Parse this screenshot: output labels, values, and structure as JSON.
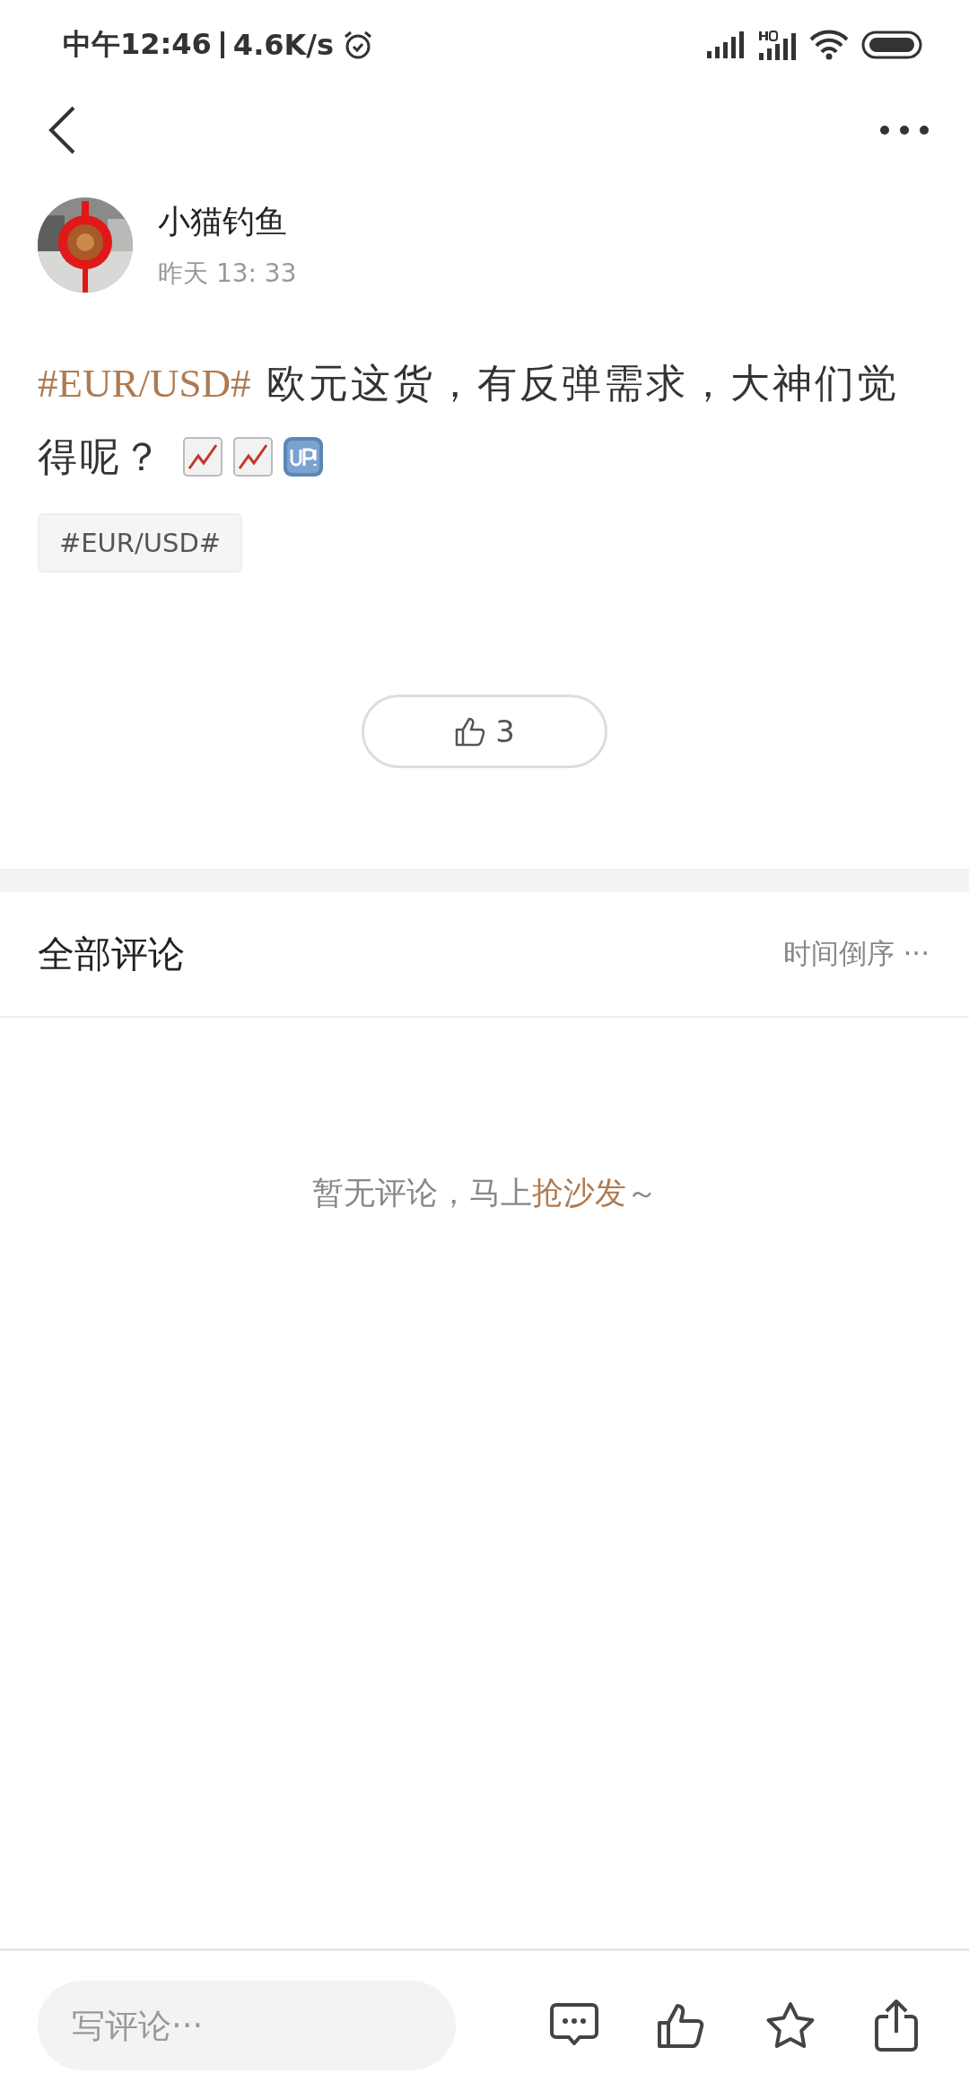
{
  "status_bar": {
    "time": "中午12:46",
    "speed": "4.6K/s"
  },
  "post": {
    "author": "小猫钓鱼",
    "time": "昨天 13: 33",
    "hashtag": "#EUR/USD#",
    "text_lines": [
      "欧元这货，有反弹需求，大神们觉",
      "得呢？"
    ],
    "tag_chip": "#EUR/USD#",
    "likes": "3"
  },
  "comments": {
    "title": "全部评论",
    "sort": "时间倒序 ···",
    "empty_text": "暂无评论，马上",
    "empty_link": "抢沙发",
    "empty_tail": "～"
  },
  "bottom_bar": {
    "placeholder": "写评论···"
  }
}
